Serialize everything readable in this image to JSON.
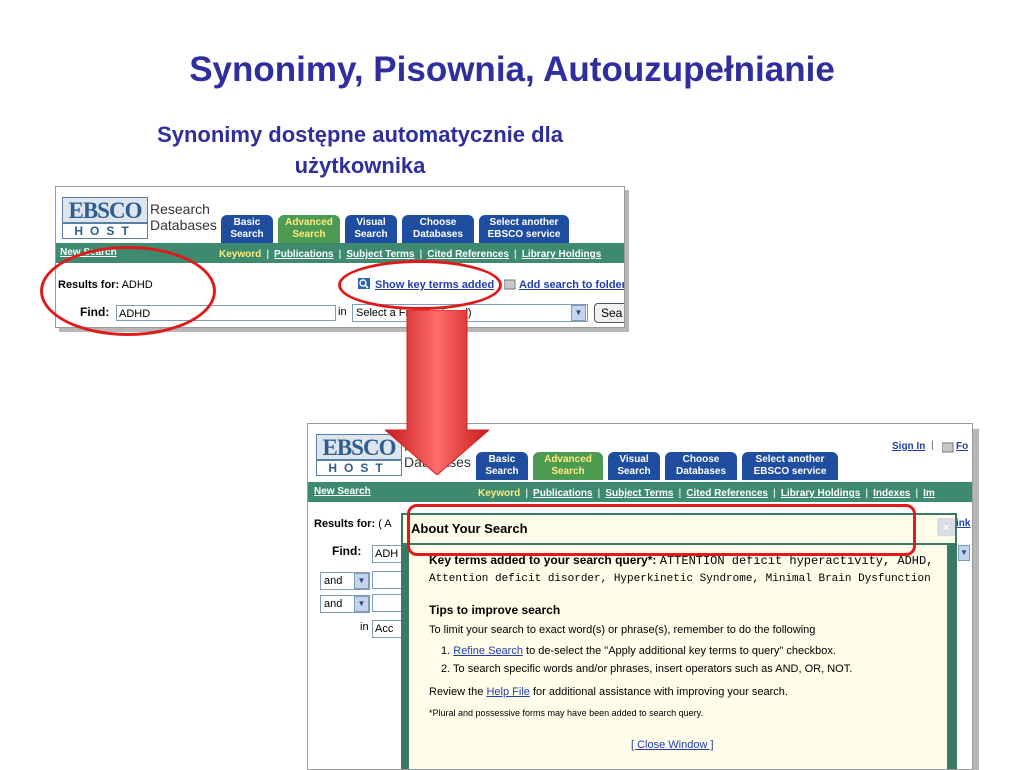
{
  "slide": {
    "title": "Synonimy, Pisownia, Autouzupełnianie",
    "subtitle_line1": "Synonimy dostępne automatycznie dla",
    "subtitle_line2": "użytkownika"
  },
  "logo": {
    "top": "EBSCO",
    "bottom": "HOST",
    "research": "Research",
    "databases": "Databases"
  },
  "tabs": {
    "basic": [
      "Basic",
      "Search"
    ],
    "advanced": [
      "Advanced",
      "Search"
    ],
    "visual": [
      "Visual",
      "Search"
    ],
    "choose": [
      "Choose",
      "Databases"
    ],
    "select": [
      "Select another",
      "EBSCO service"
    ]
  },
  "nav": {
    "new_search": "New Search",
    "keyword": "Keyword",
    "publications": "Publications",
    "subject_terms": "Subject Terms",
    "cited_references": "Cited References",
    "library_holdings": "Library Holdings",
    "indexes": "Indexes",
    "more": "Im"
  },
  "top_shot": {
    "results_label": "Results for:",
    "results_value": "ADHD",
    "show_key_terms": "Show key terms added",
    "add_to_folder": "Add search to folder",
    "find_label": "Find:",
    "find_value": "ADHD",
    "in_label": "in",
    "field_select": "Select a Field (optional)",
    "search_button": "Sea"
  },
  "bottom_shot": {
    "sign_in": "Sign In",
    "folder": "Fo",
    "results_label": "Results for:",
    "results_value": "( A",
    "find_label": "Find:",
    "find_value": "ADH",
    "and1": "and",
    "and2": "and",
    "in_label": "in",
    "in_value": "Acc",
    "right_link": "ink"
  },
  "popup": {
    "title": "About Your Search",
    "key_terms_label": "Key terms added to your search query*:",
    "key_terms_1": "ATTENTION deficit hyperactivity, ADHD,",
    "key_terms_2": "Attention deficit disorder, Hyperkinetic Syndrome, Minimal Brain Dysfunction",
    "tips_title": "Tips to improve search",
    "tips_intro": "To limit your search to exact word(s) or phrase(s), remember to do the following",
    "tip1_num": "1.",
    "tip1_link": "Refine Search",
    "tip1_rest": "to de-select the \"Apply additional key terms to query\" checkbox.",
    "tip2": "2. To search specific words and/or phrases, insert operators such as AND, OR, NOT.",
    "review_pre": "Review the",
    "help_link": "Help File",
    "review_post": "for additional assistance with improving your search.",
    "note": "*Plural and possessive forms may have been added to search query.",
    "close_window": "[ Close Window ]",
    "close_icon": "×"
  },
  "colors": {
    "title": "#2e2e9e",
    "annotation": "#e01a1a",
    "tab_blue": "#1f4ea0",
    "tab_active": "#4d9a52",
    "nav_green": "#3d8a6f"
  }
}
